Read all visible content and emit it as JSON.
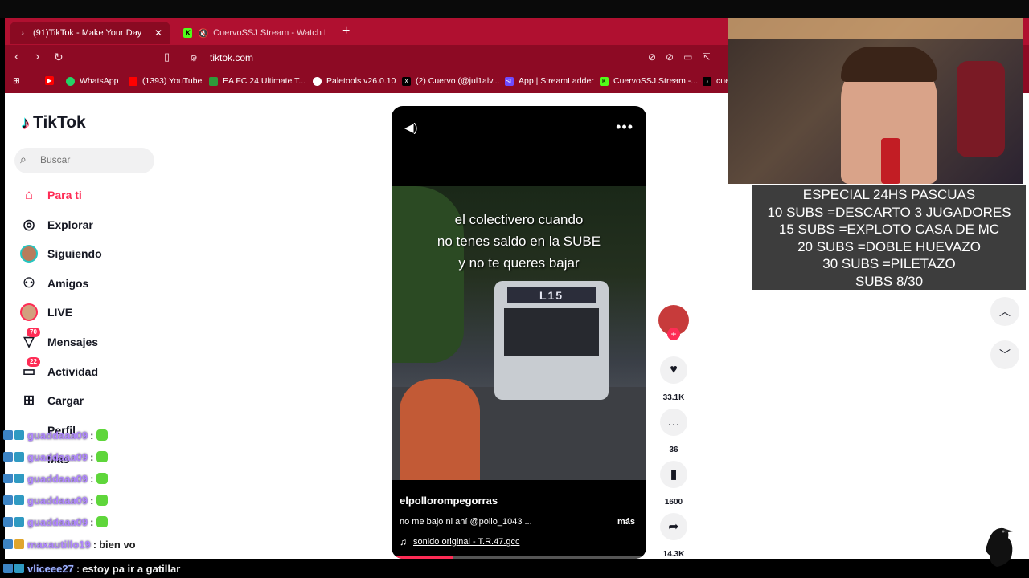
{
  "browser": {
    "tabs": [
      {
        "label": "(91)TikTok - Make Your Day",
        "active": true
      },
      {
        "label": "CuervoSSJ Stream - Watch Live o",
        "active": false
      }
    ],
    "url": "tiktok.com",
    "bookmarks": [
      {
        "label": "WhatsApp",
        "color": "#25d366"
      },
      {
        "label": "(1393) YouTube",
        "color": "#ff0000"
      },
      {
        "label": "EA FC 24 Ultimate T...",
        "color": "#2f9a3a"
      },
      {
        "label": "Paletools v26.0.10",
        "color": "#ffffff"
      },
      {
        "label": "(2) Cuervo (@jul1alv...",
        "color": "#000000"
      },
      {
        "label": "App | StreamLadder",
        "color": "#6e4bff"
      },
      {
        "label": "CuervoSSJ Stream -...",
        "color": "#53fc18"
      },
      {
        "label": "cue",
        "color": "#000000"
      }
    ]
  },
  "tiktok": {
    "logo": "TikTok",
    "search_placeholder": "Buscar",
    "nav": [
      {
        "label": "Para ti",
        "icon": "home-icon"
      },
      {
        "label": "Explorar",
        "icon": "compass-icon"
      },
      {
        "label": "Siguiendo",
        "icon": "avatar"
      },
      {
        "label": "Amigos",
        "icon": "friends-icon"
      },
      {
        "label": "LIVE",
        "icon": "avatar"
      },
      {
        "label": "Mensajes",
        "icon": "send-icon",
        "badge": "70"
      },
      {
        "label": "Actividad",
        "icon": "inbox-icon",
        "badge": "22"
      },
      {
        "label": "Cargar",
        "icon": "plus-square-icon"
      },
      {
        "label": "Perfil"
      },
      {
        "label": "Más"
      }
    ],
    "video": {
      "overlay_text": "el colectivero cuando\nno tenes saldo en la SUBE\ny no te queres bajar",
      "bus_sign": "L15",
      "author": "elpollorompegorras",
      "caption": "no me bajo ni ahí @pollo_1043 ...",
      "more": "más",
      "sound": "sonido original - T.R.47.gcc",
      "progress": 0.24
    },
    "actions": {
      "likes": "33.1K",
      "comments": "36",
      "saves": "1600",
      "shares": "14.3K"
    }
  },
  "stream": {
    "promo_lines": [
      "ESPECIAL 24HS PASCUAS",
      "10 SUBS =DESCARTO 3 JUGADORES",
      "15 SUBS =EXPLOTO CASA DE MC",
      "20 SUBS =DOBLE HUEVAZO",
      "30 SUBS =PILETAZO",
      "SUBS 8/30"
    ],
    "chat": [
      {
        "user": "guaddaaa09",
        "message": ""
      },
      {
        "user": "guaddaaa09",
        "message": ""
      },
      {
        "user": "guaddaaa09",
        "message": ""
      },
      {
        "user": "guaddaaa09",
        "message": ""
      },
      {
        "user": "guaddaaa09",
        "message": ""
      },
      {
        "user": "maxautillo19",
        "message": "bien vo"
      },
      {
        "user": "vliceee27",
        "message": "estoy pa ir a gatillar"
      }
    ]
  }
}
